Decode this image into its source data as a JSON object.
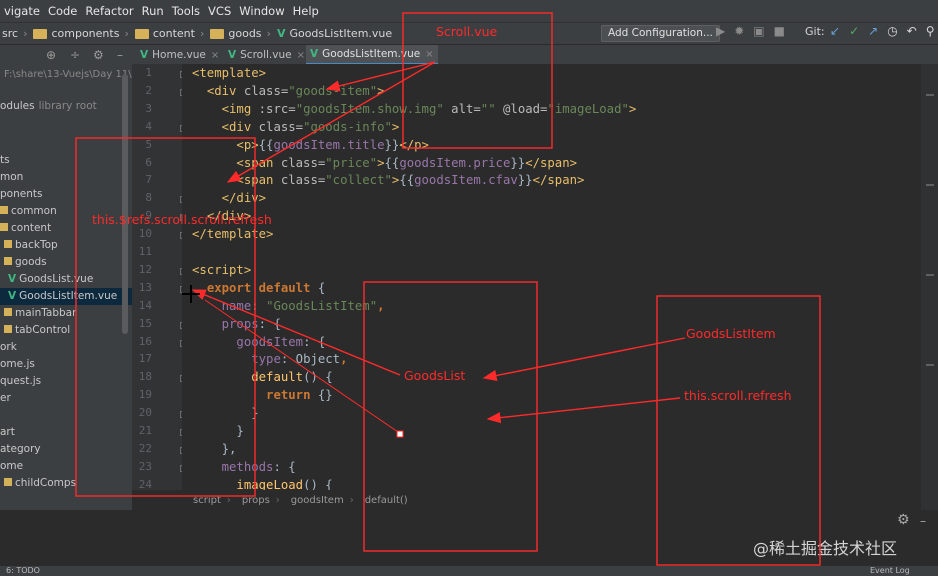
{
  "menu": [
    "vigate",
    "Code",
    "Refactor",
    "Run",
    "Tools",
    "VCS",
    "Window",
    "Help"
  ],
  "breadcrumbs": [
    "src",
    "components",
    "content",
    "goods",
    "GoodsListItem.vue"
  ],
  "toolbar": {
    "add_configuration": "Add Configuration...",
    "git_label": "Git:"
  },
  "tabs": [
    {
      "label": "Home.vue",
      "active": false
    },
    {
      "label": "Scroll.vue",
      "active": false
    },
    {
      "label": "GoodsListItem.vue",
      "active": true
    }
  ],
  "sidebar": {
    "path": "F:\\share\\13-Vuejs\\Day 11\\",
    "external_label": "odules",
    "external_note": "library root",
    "items": [
      {
        "label": "ts",
        "type": "text"
      },
      {
        "label": "mon",
        "type": "text"
      },
      {
        "label": "ponents",
        "type": "text"
      },
      {
        "label": "common",
        "type": "folder"
      },
      {
        "label": "content",
        "type": "folder"
      },
      {
        "label": "backTop",
        "type": "folder"
      },
      {
        "label": "goods",
        "type": "folder"
      },
      {
        "label": "GoodsList.vue",
        "type": "vue"
      },
      {
        "label": "GoodsListItem.vue",
        "type": "vue",
        "selected": true
      },
      {
        "label": "mainTabbar",
        "type": "folder"
      },
      {
        "label": "tabControl",
        "type": "folder"
      },
      {
        "label": "ork",
        "type": "text"
      },
      {
        "label": "ome.js",
        "type": "text"
      },
      {
        "label": "quest.js",
        "type": "text"
      },
      {
        "label": "er",
        "type": "text"
      },
      {
        "label": "",
        "type": "text"
      },
      {
        "label": "art",
        "type": "text"
      },
      {
        "label": "ategory",
        "type": "text"
      },
      {
        "label": "ome",
        "type": "text"
      },
      {
        "label": "childComps",
        "type": "folder"
      }
    ]
  },
  "editor": {
    "line_numbers": [
      "1",
      "2",
      "3",
      "4",
      "5",
      "6",
      "7",
      "8",
      "9",
      "10",
      "11",
      "12",
      "13",
      "14",
      "15",
      "16",
      "17",
      "18",
      "19",
      "20",
      "21",
      "22",
      "23",
      "24"
    ],
    "lines": [
      {
        "indent": "",
        "tokens": [
          {
            "t": "<template>",
            "c": "tag"
          }
        ]
      },
      {
        "indent": "  ",
        "tokens": [
          {
            "t": "<div ",
            "c": "tag"
          },
          {
            "t": "class=",
            "c": "attr"
          },
          {
            "t": "\"goods-item\"",
            "c": "str"
          },
          {
            "t": ">",
            "c": "tag"
          }
        ]
      },
      {
        "indent": "    ",
        "tokens": [
          {
            "t": "<img ",
            "c": "tag"
          },
          {
            "t": ":src=",
            "c": "attr"
          },
          {
            "t": "\"goodsItem.show.img\"",
            "c": "str"
          },
          {
            "t": " alt=",
            "c": "attr"
          },
          {
            "t": "\"\"",
            "c": "str"
          },
          {
            "t": " @load=",
            "c": "attr"
          },
          {
            "t": "\"imageLoad\"",
            "c": "str"
          },
          {
            "t": ">",
            "c": "tag"
          }
        ]
      },
      {
        "indent": "    ",
        "tokens": [
          {
            "t": "<div ",
            "c": "tag"
          },
          {
            "t": "class=",
            "c": "attr"
          },
          {
            "t": "\"goods-info\"",
            "c": "str"
          },
          {
            "t": ">",
            "c": "tag"
          }
        ]
      },
      {
        "indent": "      ",
        "tokens": [
          {
            "t": "<p>",
            "c": "tag"
          },
          {
            "t": "{{",
            "c": "plain"
          },
          {
            "t": "goodsItem.title",
            "c": "mus"
          },
          {
            "t": "}}",
            "c": "plain"
          },
          {
            "t": "</p>",
            "c": "tag"
          }
        ]
      },
      {
        "indent": "      ",
        "tokens": [
          {
            "t": "<span ",
            "c": "tag"
          },
          {
            "t": "class=",
            "c": "attr"
          },
          {
            "t": "\"price\"",
            "c": "str"
          },
          {
            "t": ">",
            "c": "tag"
          },
          {
            "t": "{{",
            "c": "plain"
          },
          {
            "t": "goodsItem.price",
            "c": "mus"
          },
          {
            "t": "}}",
            "c": "plain"
          },
          {
            "t": "</span>",
            "c": "tag"
          }
        ]
      },
      {
        "indent": "      ",
        "tokens": [
          {
            "t": "<span ",
            "c": "tag"
          },
          {
            "t": "class=",
            "c": "attr"
          },
          {
            "t": "\"collect\"",
            "c": "str"
          },
          {
            "t": ">",
            "c": "tag"
          },
          {
            "t": "{{",
            "c": "plain"
          },
          {
            "t": "goodsItem.cfav",
            "c": "mus"
          },
          {
            "t": "}}",
            "c": "plain"
          },
          {
            "t": "</span>",
            "c": "tag"
          }
        ]
      },
      {
        "indent": "    ",
        "tokens": [
          {
            "t": "</div>",
            "c": "tag"
          }
        ]
      },
      {
        "indent": "  ",
        "tokens": [
          {
            "t": "</div>",
            "c": "tag"
          }
        ]
      },
      {
        "indent": "",
        "tokens": [
          {
            "t": "</template>",
            "c": "tag"
          }
        ]
      },
      {
        "indent": "",
        "tokens": []
      },
      {
        "indent": "",
        "tokens": [
          {
            "t": "<script>",
            "c": "tag"
          }
        ]
      },
      {
        "indent": "  ",
        "tokens": [
          {
            "t": "export default ",
            "c": "kw"
          },
          {
            "t": "{",
            "c": "plain"
          }
        ]
      },
      {
        "indent": "    ",
        "tokens": [
          {
            "t": "name",
            "c": "prop"
          },
          {
            "t": ": ",
            "c": "plain"
          },
          {
            "t": "\"GoodsListItem\"",
            "c": "str"
          },
          {
            "t": ",",
            "c": "kw"
          }
        ]
      },
      {
        "indent": "    ",
        "tokens": [
          {
            "t": "props",
            "c": "prop"
          },
          {
            "t": ": {",
            "c": "plain"
          }
        ]
      },
      {
        "indent": "      ",
        "tokens": [
          {
            "t": "goodsItem",
            "c": "prop"
          },
          {
            "t": ": {",
            "c": "plain"
          }
        ]
      },
      {
        "indent": "        ",
        "tokens": [
          {
            "t": "type",
            "c": "prop"
          },
          {
            "t": ": Object",
            "c": "plain"
          },
          {
            "t": ",",
            "c": "kw"
          }
        ]
      },
      {
        "indent": "        ",
        "tokens": [
          {
            "t": "default",
            "c": "fn"
          },
          {
            "t": "() {",
            "c": "plain"
          }
        ]
      },
      {
        "indent": "          ",
        "tokens": [
          {
            "t": "return ",
            "c": "kw"
          },
          {
            "t": "{}",
            "c": "plain"
          }
        ]
      },
      {
        "indent": "        ",
        "tokens": [
          {
            "t": "}",
            "c": "plain"
          }
        ]
      },
      {
        "indent": "      ",
        "tokens": [
          {
            "t": "}",
            "c": "plain"
          }
        ]
      },
      {
        "indent": "    ",
        "tokens": [
          {
            "t": "},",
            "c": "plain"
          }
        ]
      },
      {
        "indent": "    ",
        "tokens": [
          {
            "t": "methods",
            "c": "prop"
          },
          {
            "t": ": {",
            "c": "plain"
          }
        ]
      },
      {
        "indent": "      ",
        "tokens": [
          {
            "t": "imageLoad",
            "c": "fn"
          },
          {
            "t": "() {",
            "c": "plain"
          }
        ]
      }
    ]
  },
  "code_breadcrumb": [
    "script",
    "props",
    "goodsItem",
    "default()"
  ],
  "status": {
    "todo": "6: TODO",
    "event_log": "Event Log"
  },
  "watermark": "@稀土掘金技术社区",
  "annotations": {
    "scroll_vue": "Scroll.vue",
    "this_refs": "this.$refs.scroll.scroll.refresh",
    "goods_list": "GoodsList",
    "goods_list_item": "GoodsListItem",
    "this_scroll_refresh": "this.scroll.refresh",
    "annotation_color": "#ff2a2a"
  }
}
